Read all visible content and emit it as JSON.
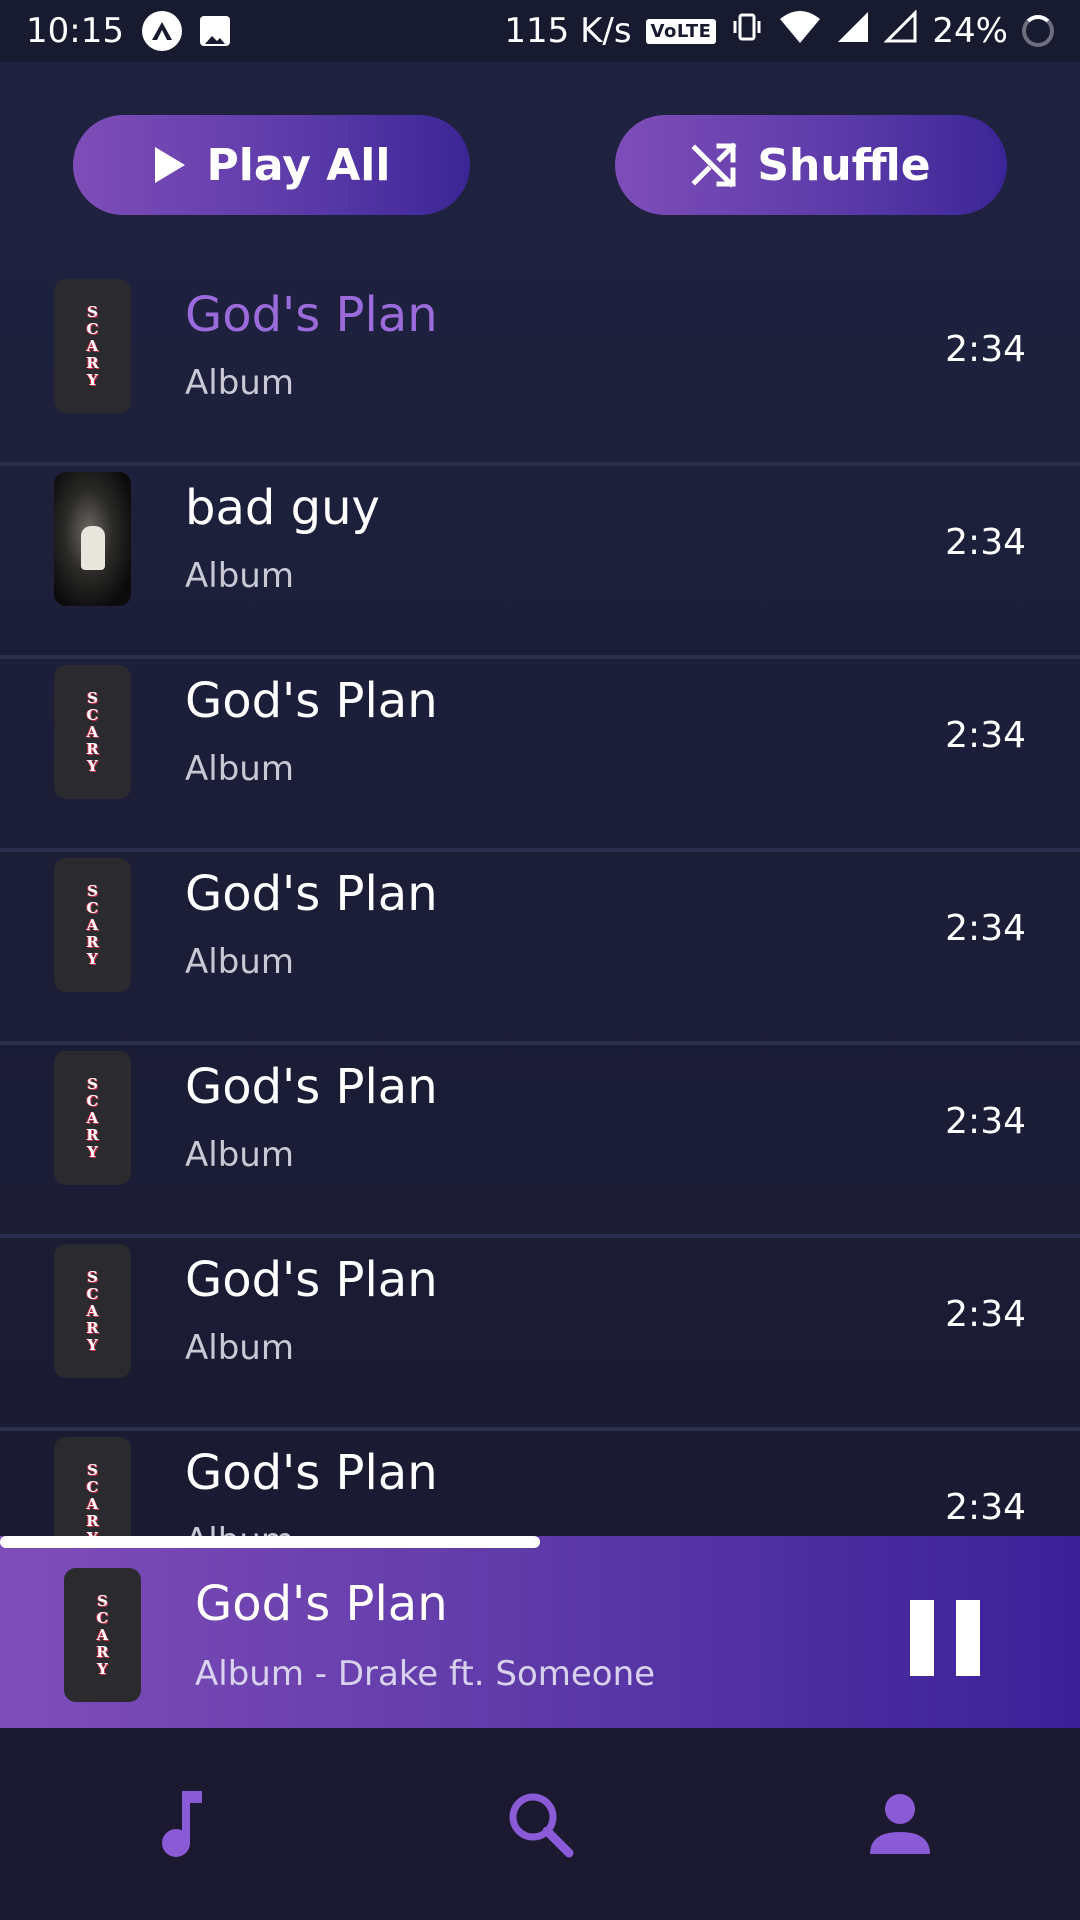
{
  "status_bar": {
    "time": "10:15",
    "network_speed": "115 K/s",
    "volte_label": "VoLTE",
    "battery": "24%"
  },
  "actions": {
    "play_all_label": "Play All",
    "shuffle_label": "Shuffle"
  },
  "tracks": [
    {
      "title": "God's Plan",
      "subtitle": "Album",
      "duration": "2:34",
      "art": "scary-cover",
      "active": true
    },
    {
      "title": "bad guy",
      "subtitle": "Album",
      "duration": "2:34",
      "art": "photo-cover",
      "active": false
    },
    {
      "title": "God's Plan",
      "subtitle": "Album",
      "duration": "2:34",
      "art": "scary-cover",
      "active": false
    },
    {
      "title": "God's Plan",
      "subtitle": "Album",
      "duration": "2:34",
      "art": "scary-cover",
      "active": false
    },
    {
      "title": "God's Plan",
      "subtitle": "Album",
      "duration": "2:34",
      "art": "scary-cover",
      "active": false
    },
    {
      "title": "God's Plan",
      "subtitle": "Album",
      "duration": "2:34",
      "art": "scary-cover",
      "active": false
    },
    {
      "title": "God's Plan",
      "subtitle": "Album",
      "duration": "2:34",
      "art": "scary-cover",
      "active": false
    }
  ],
  "cover_letters": [
    "S",
    "C",
    "A",
    "R",
    "Y"
  ],
  "now_playing": {
    "title": "God's Plan",
    "subtitle": "Album - Drake ft. Someone",
    "progress": 0.5
  },
  "bottom_nav": {
    "items": [
      "music-note-icon",
      "search-icon",
      "profile-icon"
    ],
    "accent_color": "#8b5ad6"
  },
  "colors": {
    "active_title": "#9b6bdc",
    "gradient_start": "#7f4db8",
    "gradient_end": "#3b2596"
  }
}
